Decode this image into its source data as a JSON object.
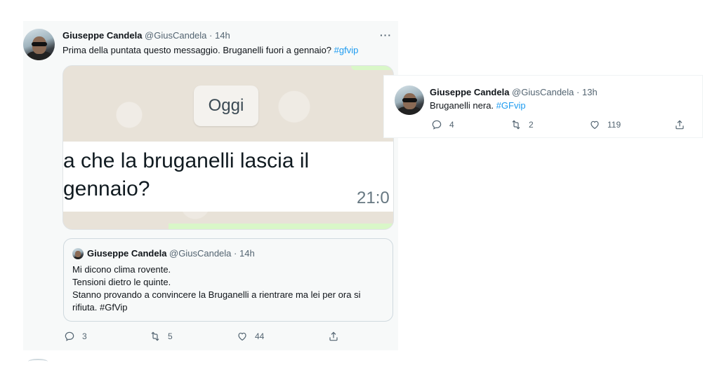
{
  "tweet1": {
    "author_name": "Giuseppe Candela",
    "author_handle": "@GiusCandela",
    "separator": "·",
    "time": "14h",
    "more": "···",
    "text": "Prima della puntata questo messaggio. Bruganelli fuori a gennaio? ",
    "hashtag": "#gfvip",
    "media": {
      "date_pill": "Oggi",
      "line1": "a che la bruganelli lascia il",
      "line2": "gennaio?",
      "time": "21:0"
    },
    "quote": {
      "author_name": "Giuseppe Candela",
      "author_handle": "@GiusCandela",
      "separator": "·",
      "time": "14h",
      "line1": "Mi dicono clima rovente.",
      "line2": "Tensioni dietro le quinte.",
      "line3": "Stanno provando a convincere la Bruganelli a rientrare ma lei per ora si",
      "line4": "rifiuta. ",
      "hashtag": "#GfVip"
    },
    "actions": {
      "replies": "3",
      "retweets": "5",
      "likes": "44"
    }
  },
  "tweet2": {
    "author_name": "Giuseppe Candela",
    "author_handle": "@GiusCandela",
    "separator": "·",
    "time": "13h",
    "text": "Bruganelli nera. ",
    "hashtag": "#GFvip",
    "actions": {
      "replies": "4",
      "retweets": "2",
      "likes": "119"
    }
  },
  "colors": {
    "link": "#1d9bf0",
    "muted": "#536471",
    "text": "#0f1419"
  }
}
